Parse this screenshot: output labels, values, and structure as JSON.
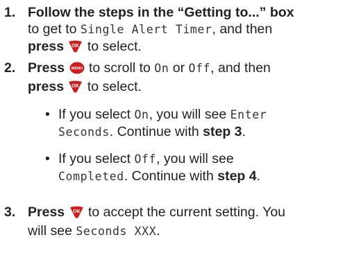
{
  "step1": {
    "num": "1.",
    "bold1": "Follow the steps in the “Getting to...” box",
    "t1": "to get to",
    "lcd1": "Single Alert Timer",
    "t2": ", and then",
    "bold2": "press",
    "t3": "to select."
  },
  "step2": {
    "num": "2.",
    "bold1": "Press",
    "t1": "to scroll to",
    "lcd1": "On",
    "t2": "or",
    "lcd2": "Off",
    "t3": ", and then",
    "bold2": "press",
    "t4": "to select."
  },
  "bullet1": {
    "dot": "•",
    "t1": "If you select",
    "lcd1": "On",
    "t2": ", you will see",
    "lcd2a": "Enter",
    "lcd2b": "Seconds",
    "t3": ". Continue with",
    "bold": "step 3",
    "t4": "."
  },
  "bullet2": {
    "dot": "•",
    "t1": "If you select",
    "lcd1": "Off",
    "t2": ", you will see",
    "lcd2": "Completed",
    "t3": ". Continue with",
    "bold": "step 4",
    "t4": "."
  },
  "step3": {
    "num": "3.",
    "bold1": "Press",
    "t1": "to accept the current setting. You",
    "t2": "will see",
    "lcd1": "Seconds XXX",
    "t3": "."
  },
  "icons": {
    "ok_label": "OK",
    "menu_label": "MENU",
    "ok_color": "#cc1f1f",
    "menu_color": "#cc1f1f"
  }
}
